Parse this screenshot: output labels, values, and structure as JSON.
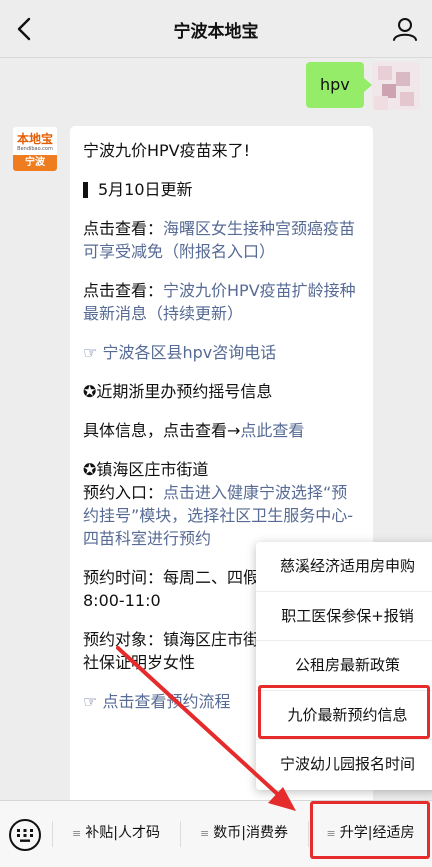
{
  "header": {
    "title": "宁波本地宝",
    "back_icon": "chevron-left-icon",
    "profile_icon": "person-icon"
  },
  "chat": {
    "user_message": "hpv",
    "bot_avatar": {
      "logo_text": "本地宝",
      "logo_sub": "Bendibao.com",
      "city": "宁波"
    },
    "bot_message": {
      "headline": "宁波九价HPV疫苗来了!",
      "update": "5月10日更新",
      "p1_prefix": "点击查看：",
      "p1_link": "海曙区女生接种宫颈癌疫苗可享受减免（附报名入口）",
      "p2_prefix": "点击查看：",
      "p2_link": "宁波九价HPV疫苗扩龄接种最新消息（持续更新）",
      "p3_icon": "☞",
      "p3_link": "宁波各区县hpv咨询电话",
      "p4": "✪近期浙里办预约摇号信息",
      "p5_prefix": "具体信息，点击查看→",
      "p5_link": "点此查看",
      "p6_title": "✪镇海区庄市街道",
      "p6_prefix": "预约入口：",
      "p6_link": "点击进入健康宁波选择“预约挂号”模块，选择社区卫生服务中心-四苗科室进行预约",
      "p7": "预约时间：每周二、四假日）上午8:00-11:0",
      "p8": "预约对象：镇海区庄市街或居住证明、社保证明岁女性",
      "p9_icon": "☞",
      "p9_link": "点击查看预约流程"
    }
  },
  "popup_menu": {
    "items": [
      "慈溪经济适用房申购",
      "职工医保参保+报销",
      "公租房最新政策",
      "九价最新预约信息",
      "宁波幼儿园报名时间"
    ]
  },
  "tabbar": {
    "keyboard_icon": "keyboard-icon",
    "tabs": [
      "补贴|人才码",
      "数币|消费券",
      "升学|经适房"
    ],
    "menu_marker": "≡"
  },
  "colors": {
    "user_bubble": "#95ec69",
    "link": "#576b95",
    "highlight": "#e52b2b",
    "logo_orange": "#ef7d1f"
  }
}
